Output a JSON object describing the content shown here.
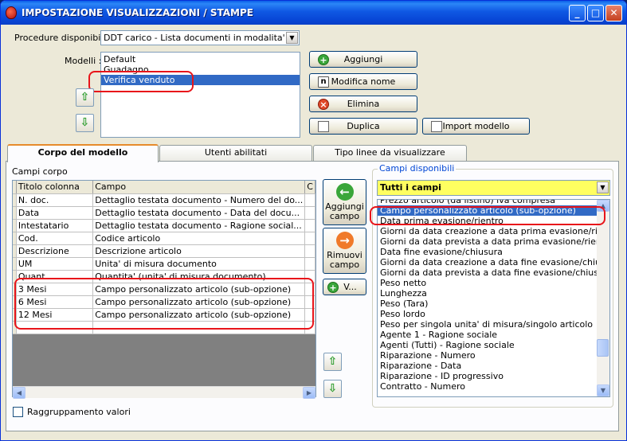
{
  "window": {
    "title": "IMPOSTAZIONE VISUALIZZAZIONI / STAMPE",
    "minimize_label": "_",
    "maximize_label": "□",
    "close_label": "✕"
  },
  "procedure": {
    "label": "Procedure disponibili :",
    "value": "DDT carico - Lista documenti in modalita' dettag"
  },
  "modelli": {
    "label": "Modelli :",
    "items": [
      "Default",
      "Guadagno",
      "Verifica venduto"
    ],
    "selected_index": 2
  },
  "model_buttons": {
    "aggiungi": "Aggiungi",
    "modifica": "Modifica nome",
    "elimina": "Elimina",
    "duplica": "Duplica",
    "import": "Import modello"
  },
  "tabs": [
    "Corpo del modello",
    "Utenti abilitati",
    "Tipo linee da visualizzare"
  ],
  "corpo": {
    "section_label": "Campi corpo",
    "columns": [
      "Titolo colonna",
      "Campo",
      "C"
    ],
    "rows": [
      [
        "N. doc.",
        "Dettaglio testata documento - Numero del do..."
      ],
      [
        "Data",
        "Dettaglio testata documento - Data del docu..."
      ],
      [
        "Intestatario",
        "Dettaglio testata documento - Ragione social..."
      ],
      [
        "Cod.",
        "Codice articolo"
      ],
      [
        "Descrizione",
        "Descrizione articolo"
      ],
      [
        "UM",
        "Unita' di misura documento"
      ],
      [
        "Quant.",
        "Quantita' (unita' di misura documento)"
      ],
      [
        "3 Mesi",
        "Campo personalizzato articolo (sub-opzione)"
      ],
      [
        "6 Mesi",
        "Campo personalizzato articolo (sub-opzione)"
      ],
      [
        "12 Mesi",
        "Campo personalizzato articolo (sub-opzione)"
      ]
    ]
  },
  "mid_buttons": {
    "aggiungi_campo": "Aggiungi campo",
    "rimuovi_campo": "Rimuovi campo",
    "v": "V..."
  },
  "disponibili": {
    "label": "Campi disponibili",
    "filter": "Tutti i campi",
    "items": [
      "Prezzo articolo (da listino) iva compresa",
      "Campo personalizzato articolo (sub-opzione)",
      "Data prima evasione/rientro",
      "Giorni da data creazione a data prima evasione/rientro",
      "Giorni da data prevista a data prima evasione/rientro",
      "Data fine evasione/chiusura",
      "Giorni da data creazione a data fine evasione/chiusura",
      "Giorni da data prevista a data fine evasione/chiusura",
      "Peso netto",
      "Lunghezza",
      "Peso (Tara)",
      "Peso lordo",
      "Peso per singola unita' di misura/singolo articolo",
      "Agente 1 - Ragione sociale",
      "Agenti (Tutti) - Ragione sociale",
      "Riparazione - Numero",
      "Riparazione - Data",
      "Riparazione - ID progressivo",
      "Contratto - Numero"
    ],
    "selected_index": 1
  },
  "raggruppamento": "Raggruppamento valori",
  "colors": {
    "titlebar": "#0a56e0",
    "selection": "#316ac5",
    "highlight": "#e8141a",
    "filter_bg": "#ffff60"
  }
}
